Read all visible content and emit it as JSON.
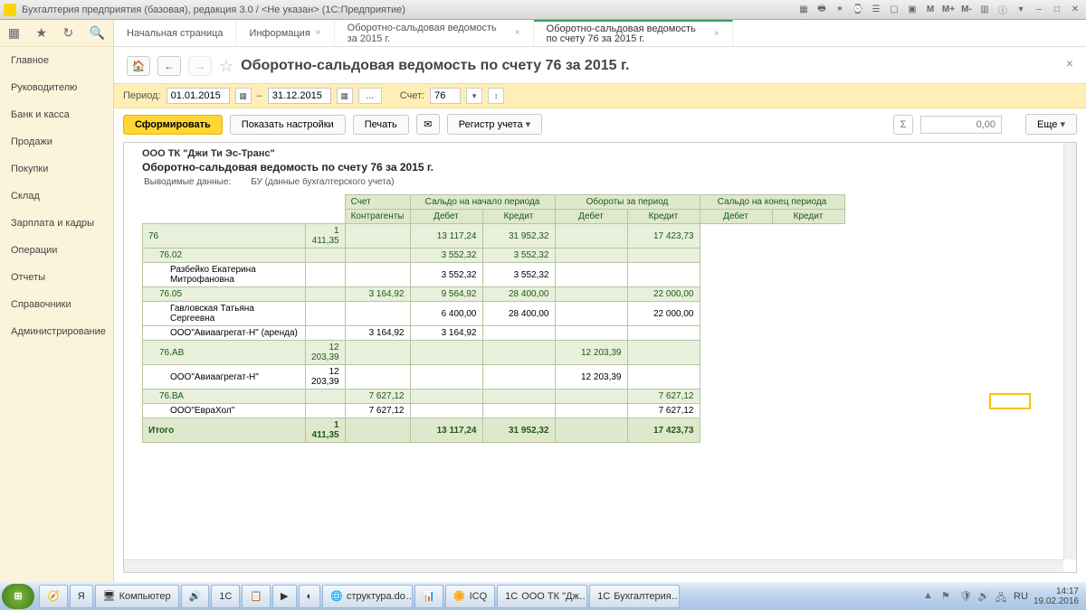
{
  "window_title": "Бухгалтерия предприятия (базовая), редакция 3.0 / <Не указан>  (1С:Предприятие)",
  "sysicons": [
    "M",
    "M+",
    "M-"
  ],
  "sidebar": {
    "items": [
      "Главное",
      "Руководителю",
      "Банк и касса",
      "Продажи",
      "Покупки",
      "Склад",
      "Зарплата и кадры",
      "Операции",
      "Отчеты",
      "Справочники",
      "Администрирование"
    ]
  },
  "tabs": [
    {
      "label": "Начальная страница",
      "closable": false
    },
    {
      "label": "Информация",
      "closable": true
    },
    {
      "label": "Оборотно-сальдовая ведомость за 2015 г.",
      "closable": true
    },
    {
      "label": "Оборотно-сальдовая ведомость по счету 76 за 2015 г.",
      "closable": true,
      "active": true
    }
  ],
  "page_title": "Оборотно-сальдовая ведомость по счету 76 за 2015 г.",
  "filter": {
    "period_label": "Период:",
    "from": "01.01.2015",
    "dash": "–",
    "to": "31.12.2015",
    "account_label": "Счет:",
    "account": "76"
  },
  "actions": {
    "generate": "Сформировать",
    "show_settings": "Показать настройки",
    "print": "Печать",
    "register": "Регистр учета",
    "sum_value": "0,00",
    "more": "Еще"
  },
  "report": {
    "company": "ООО ТК \"Джи Ти Эс-Транс\"",
    "title": "Оборотно-сальдовая ведомость по счету 76 за 2015 г.",
    "out_label": "Выводимые данные:",
    "out_value": "БУ (данные бухгалтерского учета)",
    "headers": {
      "account": "Счет",
      "counterparty": "Контрагенты",
      "start_balance": "Сальдо на начало периода",
      "turnover": "Обороты за период",
      "end_balance": "Сальдо на конец периода",
      "debit": "Дебет",
      "credit": "Кредит"
    },
    "rows": [
      {
        "lvl": 0,
        "name": "76",
        "sd": "1 411,35",
        "sc": "",
        "td": "13 117,24",
        "tc": "31 952,32",
        "ed": "",
        "ec": "17 423,73"
      },
      {
        "lvl": 1,
        "name": "76.02",
        "sd": "",
        "sc": "",
        "td": "3 552,32",
        "tc": "3 552,32",
        "ed": "",
        "ec": ""
      },
      {
        "lvl": 2,
        "name": "Разбейко Екатерина Митрофановна",
        "sd": "",
        "sc": "",
        "td": "3 552,32",
        "tc": "3 552,32",
        "ed": "",
        "ec": ""
      },
      {
        "lvl": 1,
        "name": "76.05",
        "sd": "",
        "sc": "3 164,92",
        "td": "9 564,92",
        "tc": "28 400,00",
        "ed": "",
        "ec": "22 000,00"
      },
      {
        "lvl": 2,
        "name": "Гавловская Татьяна Сергеевна",
        "sd": "",
        "sc": "",
        "td": "6 400,00",
        "tc": "28 400,00",
        "ed": "",
        "ec": "22 000,00"
      },
      {
        "lvl": 2,
        "name": "ООО\"Авиаагрегат-Н\" (аренда)",
        "sd": "",
        "sc": "3 164,92",
        "td": "3 164,92",
        "tc": "",
        "ed": "",
        "ec": ""
      },
      {
        "lvl": 1,
        "name": "76.АВ",
        "sd": "12 203,39",
        "sc": "",
        "td": "",
        "tc": "",
        "ed": "12 203,39",
        "ec": ""
      },
      {
        "lvl": 2,
        "name": "ООО\"Авиаагрегат-Н\"",
        "sd": "12 203,39",
        "sc": "",
        "td": "",
        "tc": "",
        "ed": "12 203,39",
        "ec": ""
      },
      {
        "lvl": 1,
        "name": "76.ВА",
        "sd": "",
        "sc": "7 627,12",
        "td": "",
        "tc": "",
        "ed": "",
        "ec": "7 627,12"
      },
      {
        "lvl": 2,
        "name": "ООО\"ЕвраХол\"",
        "sd": "",
        "sc": "7 627,12",
        "td": "",
        "tc": "",
        "ed": "",
        "ec": "7 627,12"
      }
    ],
    "total": {
      "label": "Итого",
      "sd": "1 411,35",
      "sc": "",
      "td": "13 117,24",
      "tc": "31 952,32",
      "ed": "",
      "ec": "17 423,73"
    }
  },
  "taskbar": {
    "items": [
      "",
      "Компьютер",
      "",
      "",
      "",
      "",
      "",
      "структура.do…",
      "",
      "ICQ",
      "ООО ТК \"Дж…",
      "Бухгалтерия…"
    ],
    "time": "14:17",
    "date": "19.02.2016"
  }
}
